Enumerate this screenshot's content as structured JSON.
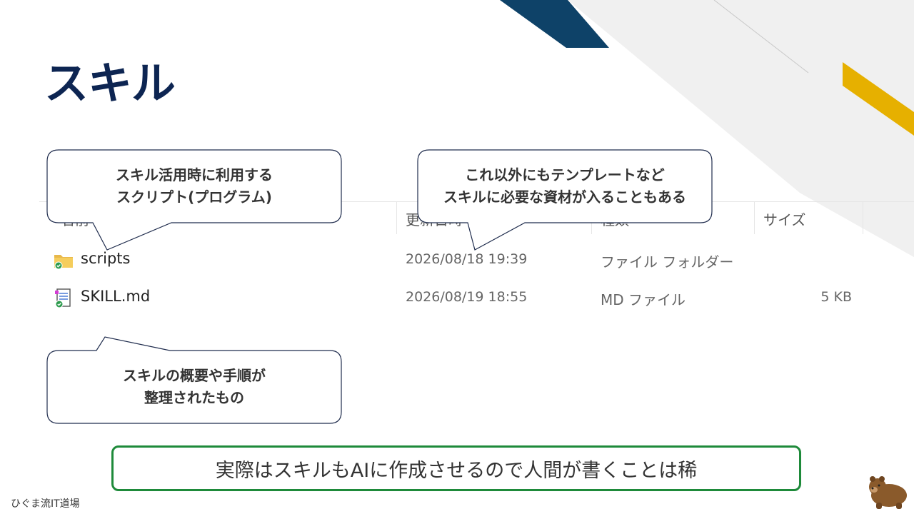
{
  "slide": {
    "title": "スキル",
    "footer": "ひぐま流IT道場"
  },
  "explorer": {
    "columns": [
      "名前",
      "更新日時",
      "種類",
      "サイズ"
    ],
    "rows": [
      {
        "name": "scripts",
        "date": "2026/08/18 19:39",
        "type": "ファイル フォルダー",
        "size": "",
        "icon": "folder-icon"
      },
      {
        "name": "SKILL.md",
        "date": "2026/08/19 18:55",
        "type": "MD ファイル",
        "size": "5 KB",
        "icon": "document-icon"
      }
    ]
  },
  "callouts": {
    "scripts": {
      "line1": "スキル活用時に利用する",
      "line2": "スクリプト(プログラム)"
    },
    "others": {
      "line1": "これ以外にもテンプレートなど",
      "line2": "スキルに必要な資材が入ることもある"
    },
    "skillmd": {
      "line1": "スキルの概要や手順が",
      "line2": "整理されたもの"
    }
  },
  "banner": {
    "text": "実際はスキルもAIに作成させるので人間が書くことは稀"
  },
  "colors": {
    "navy": "#0d2552",
    "dark_blue": "#0e4268",
    "gold": "#e6b000",
    "green": "#1e8a3a",
    "light_gray": "#f0f0f0"
  }
}
